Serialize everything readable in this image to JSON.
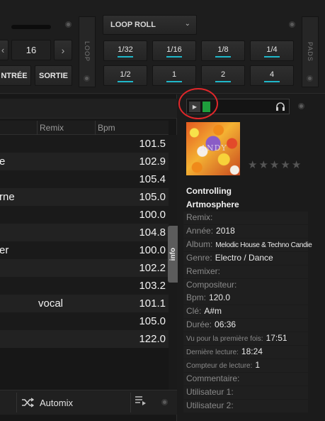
{
  "top": {
    "loop_value": "16",
    "entree_label": "NTRÉE",
    "sortie_label": "SORTIE",
    "loop_tab": "LOOP",
    "pads_tab": "PADS",
    "loop_mode": "LOOP ROLL",
    "pads": [
      "1/32",
      "1/16",
      "1/8",
      "1/4",
      "1/2",
      "1",
      "2",
      "4"
    ]
  },
  "table": {
    "col_remix": "Remix",
    "col_bpm": "Bpm",
    "rows": [
      {
        "name": "",
        "remix": "",
        "bpm": "101.5"
      },
      {
        "name": "e",
        "remix": "",
        "bpm": "102.9"
      },
      {
        "name": "",
        "remix": "",
        "bpm": "105.4"
      },
      {
        "name": "rne",
        "remix": "",
        "bpm": "105.0"
      },
      {
        "name": "",
        "remix": "",
        "bpm": "100.0"
      },
      {
        "name": "",
        "remix": "",
        "bpm": "104.8"
      },
      {
        "name": "er",
        "remix": "",
        "bpm": "100.0"
      },
      {
        "name": "",
        "remix": "",
        "bpm": "102.2"
      },
      {
        "name": "",
        "remix": "",
        "bpm": "103.2"
      },
      {
        "name": "",
        "remix": "vocal",
        "bpm": "101.1"
      },
      {
        "name": "",
        "remix": "",
        "bpm": "105.0"
      },
      {
        "name": "",
        "remix": "",
        "bpm": "122.0"
      }
    ]
  },
  "bottom": {
    "automix_label": "Automix"
  },
  "info": {
    "tab_label": "info",
    "title": "Controlling",
    "artist": "Artmosphere",
    "cover_text": "ANDY",
    "rating_stars": 0,
    "fields": [
      {
        "label": "Remix:",
        "value": ""
      },
      {
        "label": "Année:",
        "value": "2018"
      },
      {
        "label": "Album:",
        "value": "Melodic House & Techno Candie"
      },
      {
        "label": "Genre:",
        "value": "Electro / Dance"
      },
      {
        "label": "Remixer:",
        "value": ""
      },
      {
        "label": "Compositeur:",
        "value": ""
      },
      {
        "label": "Bpm:",
        "value": "120.0"
      },
      {
        "label": "Clé:",
        "value": "A#m"
      },
      {
        "label": "Durée:",
        "value": "06:36"
      },
      {
        "label": "Vu pour la première fois:",
        "value": "17:51"
      },
      {
        "label": "Dernière lecture:",
        "value": "18:24"
      },
      {
        "label": "Compteur de lecture:",
        "value": "1"
      },
      {
        "label": "Commentaire:",
        "value": ""
      },
      {
        "label": "Utilisateur 1:",
        "value": ""
      },
      {
        "label": "Utilisateur 2:",
        "value": ""
      }
    ]
  },
  "colors": {
    "accent": "#1fb7c9",
    "preview_green": "#1e9e3c",
    "highlight_ring": "#e0272a"
  }
}
